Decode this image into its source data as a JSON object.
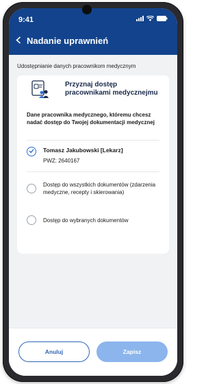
{
  "status_bar": {
    "time": "9:41"
  },
  "header": {
    "title": "Nadanie uprawnień",
    "back_label": "<"
  },
  "section_label": "Udostępnianie danych pracownikom medycznym",
  "banner": {
    "text": "Przyznaj dostęp pracownikami medycznejmu"
  },
  "card": {
    "description": "Dane pracownika medycznego, któremu chcesz nadać dostęp do Twojej dokumentacji medycznej",
    "person": {
      "name": "Tomasz Jakubowski [Lekarz]",
      "pwz": "PWZ: 2640167",
      "selected": true
    },
    "options": [
      {
        "label": "Dostęp do wszystkich dokumentów (zdarzenia medyczne, recepty i skierowania)",
        "selected": false
      },
      {
        "label": "Dostęp do wybranych dokumentów",
        "selected": false
      }
    ]
  },
  "footer": {
    "cancel_label": "Anuluj",
    "save_label": "Zapisz"
  },
  "colors": {
    "header": "#12438c",
    "accent": "#2a6fd6",
    "save_disabled": "#8bb5ec"
  }
}
